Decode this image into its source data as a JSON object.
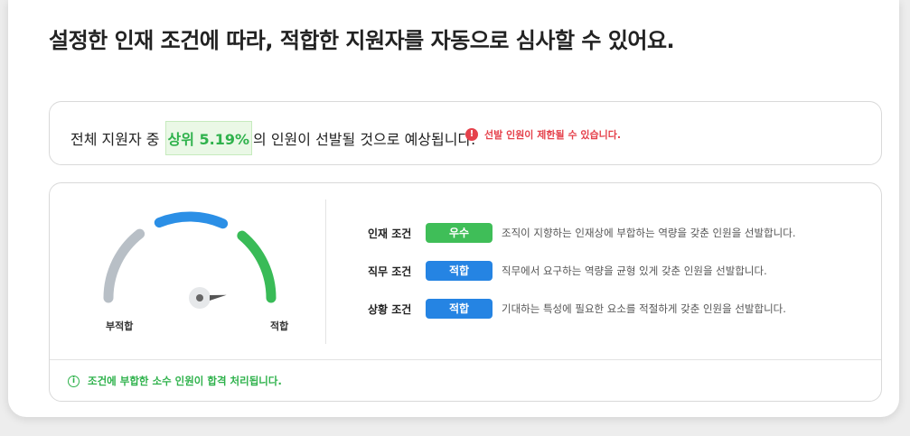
{
  "headline": "설정한 인재 조건에 따라, 적합한 지원자를 자동으로 심사할 수 있어요.",
  "prediction": {
    "prefix": "전체 지원자 중",
    "highlight": "상위 5.19%",
    "suffix": "의 인원이 선발될 것으로 예상됩니다.",
    "warning": "선발 인원이 제한될 수 있습니다.",
    "warning_icon": "alert-circle-icon",
    "warning_color": "#e5414b",
    "highlight_color": "#2fb24c"
  },
  "gauge": {
    "left_label": "부적합",
    "right_label": "적합",
    "needle_value": 0.52,
    "colors": {
      "low": "#b8bfc6",
      "mid": "#2b8fe6",
      "high": "#39bb57"
    }
  },
  "conditions": [
    {
      "name": "인재 조건",
      "badge": "우수",
      "badge_color": "#3fbe58",
      "description": "조직이 지향하는 인재상에 부합하는 역량을 갖춘 인원을 선발합니다."
    },
    {
      "name": "직무 조건",
      "badge": "적합",
      "badge_color": "#2584e3",
      "description": "직무에서 요구하는 역량을 균형 있게 갖춘 인원을 선발합니다."
    },
    {
      "name": "상황 조건",
      "badge": "적합",
      "badge_color": "#2584e3",
      "description": "기대하는 특성에 필요한 요소를 적절하게 갖춘 인원을 선발합니다."
    }
  ],
  "note": {
    "icon": "info-circle-icon",
    "text": "조건에 부합한 소수 인원이 합격 처리됩니다."
  }
}
